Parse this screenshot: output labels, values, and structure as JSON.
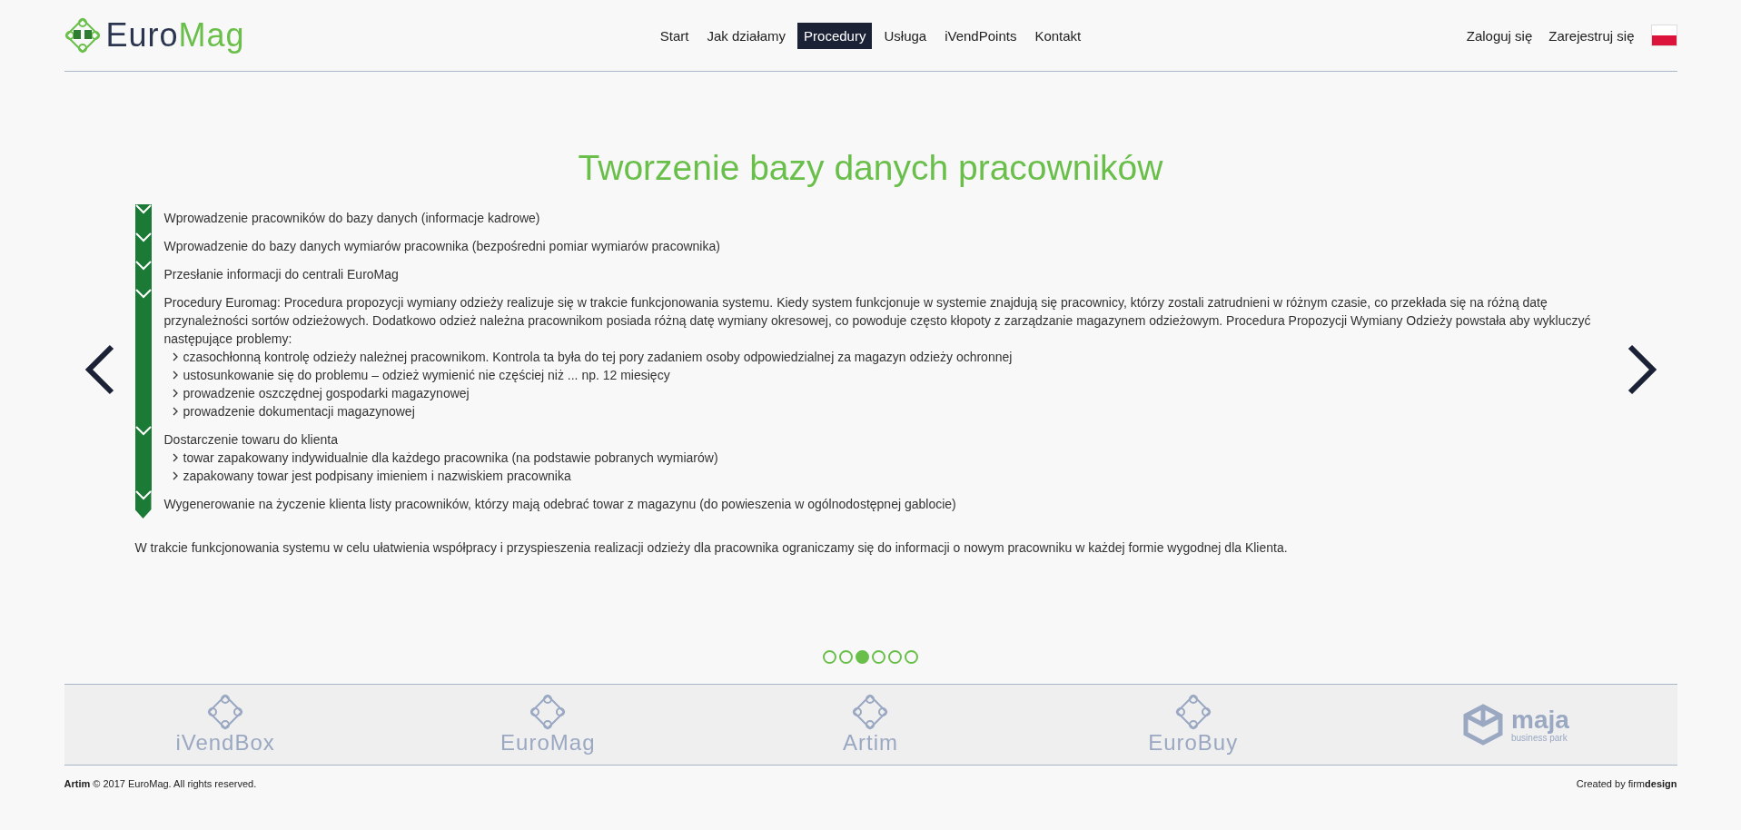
{
  "header": {
    "logo": {
      "first": "Euro",
      "second": "Mag"
    },
    "nav": [
      {
        "label": "Start",
        "selected": false
      },
      {
        "label": "Jak działamy",
        "selected": false
      },
      {
        "label": "Procedury",
        "selected": true
      },
      {
        "label": "Usługa",
        "selected": false
      },
      {
        "label": "iVendPoints",
        "selected": false
      },
      {
        "label": "Kontakt",
        "selected": false
      }
    ],
    "account_links": [
      "Zaloguj się",
      "Zarejestruj się"
    ]
  },
  "slide": {
    "title": "Tworzenie bazy danych pracowników",
    "steps": [
      {
        "text": "Wprowadzenie pracowników do bazy danych (informacje kadrowe)"
      },
      {
        "text": "Wprowadzenie do bazy danych wymiarów pracownika (bezpośredni pomiar wymiarów pracownika)"
      },
      {
        "text": "Przesłanie informacji do centrali EuroMag"
      },
      {
        "text": "Procedury Euromag: Procedura propozycji wymiany odzieży realizuje się w trakcie funkcjonowania systemu. Kiedy system funkcjonuje w systemie znajdują się pracownicy, którzy zostali zatrudnieni w różnym czasie, co przekłada się na różną datę przynależności sortów odzieżowych. Dodatkowo odzież należna pracownikom posiada różną datę wymiany okresowej, co powoduje często kłopoty z zarządzanie magazynem odzieżowym. Procedura Propozycji Wymiany Odzieży powstała aby wykluczyć następujące problemy:",
        "items": [
          "czasochłonną kontrolę odzieży należnej pracownikom. Kontrola ta była do tej pory zadaniem osoby odpowiedzialnej za magazyn odzieży ochronnej",
          "ustosunkowanie się do problemu – odzież wymienić nie częściej niż ... np. 12 miesięcy",
          "prowadzenie oszczędnej gospodarki magazynowej",
          "prowadzenie dokumentacji magazynowej"
        ]
      },
      {
        "text": "Dostarczenie towaru do klienta",
        "items": [
          "towar zapakowany indywidualnie dla każdego pracownika (na podstawie pobranych wymiarów)",
          "zapakowany towar jest podpisany imieniem i nazwiskiem pracownika"
        ]
      },
      {
        "text": "Wygenerowanie na życzenie klienta listy pracowników, którzy mają odebrać towar z magazynu (do powieszenia w ogólnodostępnej gablocie)"
      }
    ],
    "note": "W trakcie funkcjonowania systemu w celu ułatwienia współpracy i przyspieszenia realizacji odzieży dla pracownika ograniczamy się do informacji o nowym pracowniku w każdej formie wygodnej dla Klienta.",
    "dots": [
      {
        "selected": false
      },
      {
        "selected": false
      },
      {
        "selected": true
      },
      {
        "selected": false
      },
      {
        "selected": false
      },
      {
        "selected": false
      }
    ]
  },
  "partners": [
    {
      "name": "iVendBox"
    },
    {
      "name": "EuroMag"
    },
    {
      "name": "Artim"
    },
    {
      "name": "EuroBuy"
    },
    {
      "name": "maja",
      "tagline": "business park"
    }
  ],
  "footer": {
    "copyright": "**Artim** © 2017 EuroMag. All rights reserved.",
    "credit": "Created by firm**design**"
  }
}
